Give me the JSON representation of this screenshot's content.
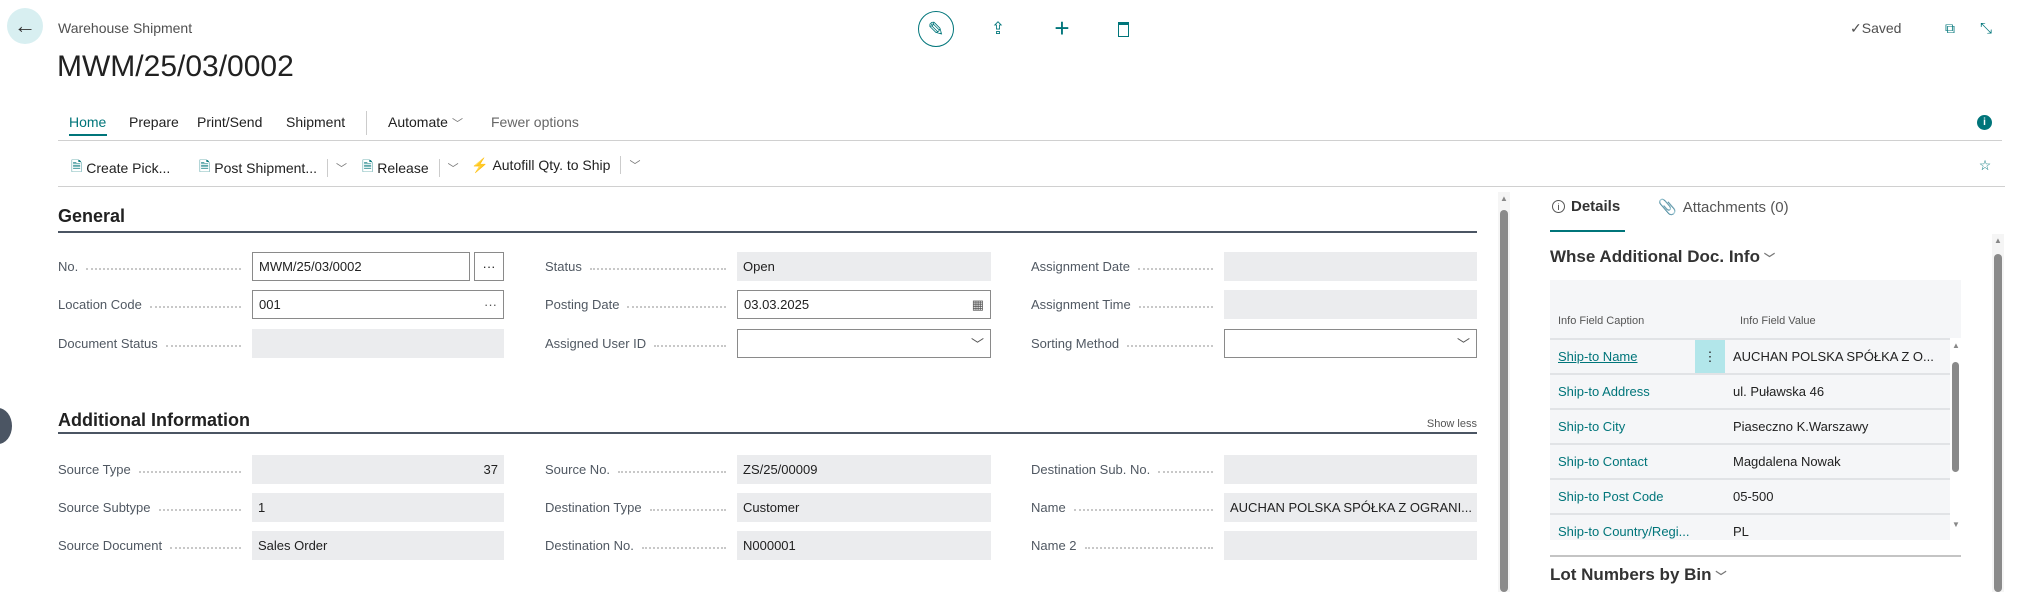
{
  "header": {
    "breadcrumb": "Warehouse Shipment",
    "title": "MWM/25/03/0002",
    "saved": "Saved"
  },
  "nav": {
    "tabs": [
      "Home",
      "Prepare",
      "Print/Send",
      "Shipment"
    ],
    "automate": "Automate",
    "fewer": "Fewer options"
  },
  "actions": {
    "create_pick": "Create Pick...",
    "post_shipment": "Post Shipment...",
    "release": "Release",
    "autofill": "Autofill Qty. to Ship"
  },
  "general": {
    "title": "General",
    "no_label": "No.",
    "no": "MWM/25/03/0002",
    "no_btn": "···",
    "location_label": "Location Code",
    "location": "001",
    "location_btn": "···",
    "docstatus_label": "Document Status",
    "docstatus": "",
    "status_label": "Status",
    "status": "Open",
    "posting_label": "Posting Date",
    "posting": "03.03.2025",
    "user_label": "Assigned User ID",
    "user": "",
    "adate_label": "Assignment Date",
    "adate": "",
    "atime_label": "Assignment Time",
    "atime": "",
    "sort_label": "Sorting Method",
    "sort": ""
  },
  "additional": {
    "title": "Additional Information",
    "show_less": "Show less",
    "stype_label": "Source Type",
    "stype": "37",
    "ssub_label": "Source Subtype",
    "ssub": "1",
    "sdoc_label": "Source Document",
    "sdoc": "Sales Order",
    "sno_label": "Source No.",
    "sno": "ZS/25/00009",
    "dtype_label": "Destination Type",
    "dtype": "Customer",
    "dno_label": "Destination No.",
    "dno": "N000001",
    "dsub_label": "Destination Sub. No.",
    "dsub": "",
    "name_label": "Name",
    "name": "AUCHAN POLSKA SPÓŁKA Z OGRANI...",
    "name2_label": "Name 2",
    "name2": ""
  },
  "factbox": {
    "details": "Details",
    "attachments": "Attachments (0)",
    "whse_title": "Whse Additional Doc. Info",
    "col1": "Info Field Caption",
    "col2": "Info Field Value",
    "rows": [
      {
        "c": "Ship-to Name",
        "v": "AUCHAN POLSKA SPÓŁKA Z O..."
      },
      {
        "c": "Ship-to Address",
        "v": "ul. Puławska 46"
      },
      {
        "c": "Ship-to City",
        "v": "Piaseczno K.Warszawy"
      },
      {
        "c": "Ship-to Contact",
        "v": "Magdalena Nowak"
      },
      {
        "c": "Ship-to Post Code",
        "v": "05-500"
      },
      {
        "c": "Ship-to Country/Regi...",
        "v": "PL"
      }
    ],
    "lot_title": "Lot Numbers by Bin"
  }
}
